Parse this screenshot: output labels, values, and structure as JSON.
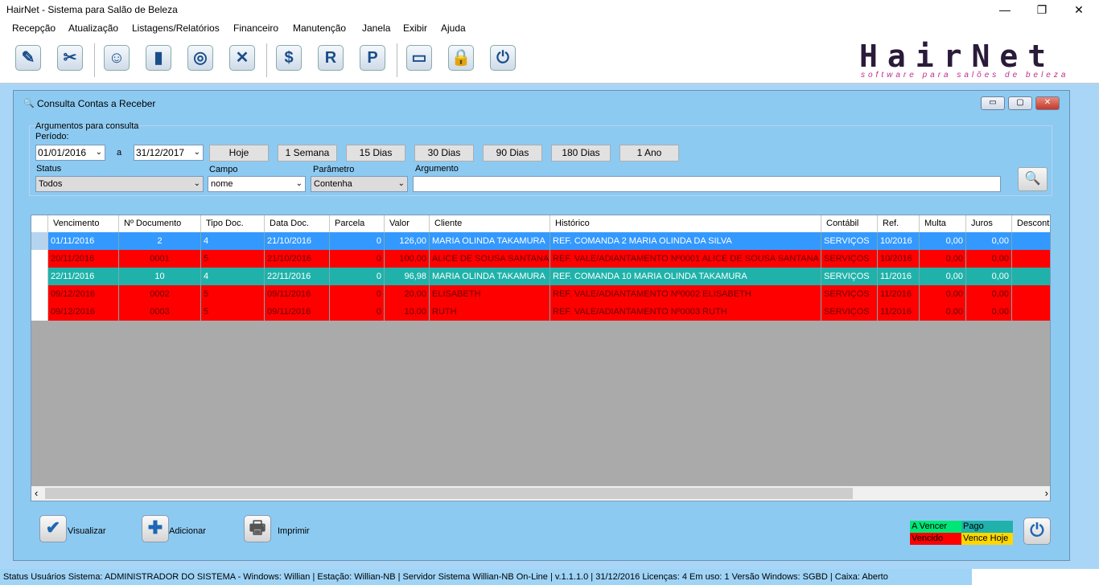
{
  "window": {
    "title": "HairNet - Sistema para Salão de Beleza",
    "minimize": "—",
    "maximize": "❐",
    "close": "✕"
  },
  "menu": [
    "Recepção",
    "Atualização",
    "Listagens/Relatórios",
    "Financeiro",
    "Manutenção",
    "Janela",
    "Exibir",
    "Ajuda"
  ],
  "toolbar": {
    "icons": [
      "agenda-icon",
      "scissors-icon",
      "clients-icon",
      "door-icon",
      "cash-register-icon",
      "tools-icon",
      "dollar-icon",
      "r-icon",
      "p-icon",
      "keyboard-icon",
      "lock-icon",
      "power-icon"
    ],
    "labels": {
      "dollar": "$",
      "r": "R",
      "p": "P"
    }
  },
  "logo": {
    "text": "HairNet",
    "tagline": "software para salões de beleza",
    "color": "#c02b8a"
  },
  "child": {
    "title": "Consulta Contas a Receber",
    "buttons": {
      "minimize": "▭",
      "restore": "▢",
      "close": "✕"
    }
  },
  "filters": {
    "group_label": "Argumentos para consulta",
    "period_label": "Período:",
    "date_from": "01/01/2016",
    "date_sep": "a",
    "date_to": "31/12/2017",
    "quick": [
      "Hoje",
      "1 Semana",
      "15 Dias",
      "30 Dias",
      "90 Dias",
      "180 Dias",
      "1 Ano"
    ],
    "status_label": "Status",
    "status_value": "Todos",
    "campo_label": "Campo",
    "campo_value": "nome",
    "param_label": "Parâmetro",
    "param_value": "Contenha",
    "arg_label": "Argumento",
    "arg_value": "",
    "search_glyph": "🔍"
  },
  "grid": {
    "columns": [
      "Vencimento",
      "Nº Documento",
      "Tipo Doc.",
      "Data Doc.",
      "Parcela",
      "Valor",
      "Cliente",
      "Histórico",
      "Contábil",
      "Ref.",
      "Multa",
      "Juros",
      "Descont"
    ],
    "rows": [
      {
        "status": "selected",
        "cells": [
          "01/11/2016",
          "2",
          "4",
          "21/10/2016",
          "0",
          "126,00",
          "MARIA OLINDA TAKAMURA",
          "REF. COMANDA 2 MARIA OLINDA DA SILVA",
          "SERVIÇOS",
          "10/2016",
          "0,00",
          "0,00",
          ""
        ]
      },
      {
        "status": "vencido",
        "cells": [
          "20/11/2016",
          "0001",
          "5",
          "21/10/2016",
          "0",
          "100,00",
          "ALICE DE SOUSA SANTANA",
          "REF. VALE/ADIANTAMENTO Nº0001 ALICE DE SOUSA SANTANA",
          "SERVIÇOS",
          "10/2016",
          "0,00",
          "0,00",
          ""
        ]
      },
      {
        "status": "pago",
        "cells": [
          "22/11/2016",
          "10",
          "4",
          "22/11/2016",
          "0",
          "96,98",
          "MARIA OLINDA TAKAMURA",
          "REF. COMANDA 10 MARIA OLINDA TAKAMURA",
          "SERVIÇOS",
          "11/2016",
          "0,00",
          "0,00",
          ""
        ]
      },
      {
        "status": "vencido",
        "cells": [
          "09/12/2016",
          "0002",
          "5",
          "09/11/2016",
          "0",
          "20,00",
          "ELISABETH",
          "REF. VALE/ADIANTAMENTO Nº0002 ELISABETH",
          "SERVIÇOS",
          "11/2016",
          "0,00",
          "0,00",
          ""
        ]
      },
      {
        "status": "vencido",
        "cells": [
          "09/12/2016",
          "0003",
          "5",
          "09/11/2016",
          "0",
          "10,00",
          "RUTH",
          "REF. VALE/ADIANTAMENTO Nº0003 RUTH",
          "SERVIÇOS",
          "11/2016",
          "0,00",
          "0,00",
          ""
        ]
      }
    ],
    "scroll_left": "‹",
    "scroll_right": "›"
  },
  "colors": {
    "selected": "#3399ff",
    "vencido": "#ff0000",
    "pago": "#20b2aa",
    "a_vencer": "#00e676",
    "vence_hoje": "#ffd700"
  },
  "actions": {
    "visualizar": "Visualizar",
    "adicionar": "Adicionar",
    "imprimir": "Imprimir",
    "visualizar_glyph": "✔",
    "adicionar_glyph": "✚",
    "imprimir_glyph": "🖶",
    "exit_glyph": "⏻"
  },
  "legend": {
    "a_vencer": "A Vencer",
    "pago": "Pago",
    "vencido": "Vencido",
    "vence_hoje": "Vence Hoje"
  },
  "status": "Status   Usuários Sistema: ADMINISTRADOR DO SISTEMA    - Windows: Willian | Estação: Willian-NB        | Servidor Sistema Willian-NB On-Line   | v.1.1.1.0   | 31/12/2016  Licenças: 4   Em uso: 1   Versão Windows:    SGBD   | Caixa: Aberto"
}
